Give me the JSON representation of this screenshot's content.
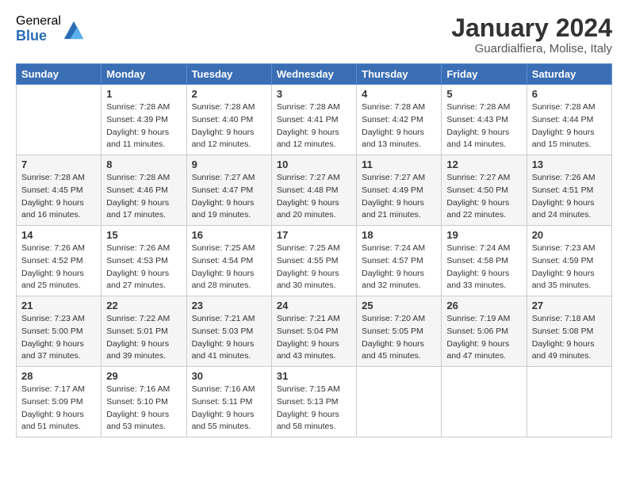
{
  "logo": {
    "general": "General",
    "blue": "Blue"
  },
  "title": "January 2024",
  "location": "Guardialfiera, Molise, Italy",
  "weekdays": [
    "Sunday",
    "Monday",
    "Tuesday",
    "Wednesday",
    "Thursday",
    "Friday",
    "Saturday"
  ],
  "weeks": [
    [
      {
        "day": "",
        "sunrise": "",
        "sunset": "",
        "daylight": ""
      },
      {
        "day": "1",
        "sunrise": "Sunrise: 7:28 AM",
        "sunset": "Sunset: 4:39 PM",
        "daylight": "Daylight: 9 hours and 11 minutes."
      },
      {
        "day": "2",
        "sunrise": "Sunrise: 7:28 AM",
        "sunset": "Sunset: 4:40 PM",
        "daylight": "Daylight: 9 hours and 12 minutes."
      },
      {
        "day": "3",
        "sunrise": "Sunrise: 7:28 AM",
        "sunset": "Sunset: 4:41 PM",
        "daylight": "Daylight: 9 hours and 12 minutes."
      },
      {
        "day": "4",
        "sunrise": "Sunrise: 7:28 AM",
        "sunset": "Sunset: 4:42 PM",
        "daylight": "Daylight: 9 hours and 13 minutes."
      },
      {
        "day": "5",
        "sunrise": "Sunrise: 7:28 AM",
        "sunset": "Sunset: 4:43 PM",
        "daylight": "Daylight: 9 hours and 14 minutes."
      },
      {
        "day": "6",
        "sunrise": "Sunrise: 7:28 AM",
        "sunset": "Sunset: 4:44 PM",
        "daylight": "Daylight: 9 hours and 15 minutes."
      }
    ],
    [
      {
        "day": "7",
        "sunrise": "Sunrise: 7:28 AM",
        "sunset": "Sunset: 4:45 PM",
        "daylight": "Daylight: 9 hours and 16 minutes."
      },
      {
        "day": "8",
        "sunrise": "Sunrise: 7:28 AM",
        "sunset": "Sunset: 4:46 PM",
        "daylight": "Daylight: 9 hours and 17 minutes."
      },
      {
        "day": "9",
        "sunrise": "Sunrise: 7:27 AM",
        "sunset": "Sunset: 4:47 PM",
        "daylight": "Daylight: 9 hours and 19 minutes."
      },
      {
        "day": "10",
        "sunrise": "Sunrise: 7:27 AM",
        "sunset": "Sunset: 4:48 PM",
        "daylight": "Daylight: 9 hours and 20 minutes."
      },
      {
        "day": "11",
        "sunrise": "Sunrise: 7:27 AM",
        "sunset": "Sunset: 4:49 PM",
        "daylight": "Daylight: 9 hours and 21 minutes."
      },
      {
        "day": "12",
        "sunrise": "Sunrise: 7:27 AM",
        "sunset": "Sunset: 4:50 PM",
        "daylight": "Daylight: 9 hours and 22 minutes."
      },
      {
        "day": "13",
        "sunrise": "Sunrise: 7:26 AM",
        "sunset": "Sunset: 4:51 PM",
        "daylight": "Daylight: 9 hours and 24 minutes."
      }
    ],
    [
      {
        "day": "14",
        "sunrise": "Sunrise: 7:26 AM",
        "sunset": "Sunset: 4:52 PM",
        "daylight": "Daylight: 9 hours and 25 minutes."
      },
      {
        "day": "15",
        "sunrise": "Sunrise: 7:26 AM",
        "sunset": "Sunset: 4:53 PM",
        "daylight": "Daylight: 9 hours and 27 minutes."
      },
      {
        "day": "16",
        "sunrise": "Sunrise: 7:25 AM",
        "sunset": "Sunset: 4:54 PM",
        "daylight": "Daylight: 9 hours and 28 minutes."
      },
      {
        "day": "17",
        "sunrise": "Sunrise: 7:25 AM",
        "sunset": "Sunset: 4:55 PM",
        "daylight": "Daylight: 9 hours and 30 minutes."
      },
      {
        "day": "18",
        "sunrise": "Sunrise: 7:24 AM",
        "sunset": "Sunset: 4:57 PM",
        "daylight": "Daylight: 9 hours and 32 minutes."
      },
      {
        "day": "19",
        "sunrise": "Sunrise: 7:24 AM",
        "sunset": "Sunset: 4:58 PM",
        "daylight": "Daylight: 9 hours and 33 minutes."
      },
      {
        "day": "20",
        "sunrise": "Sunrise: 7:23 AM",
        "sunset": "Sunset: 4:59 PM",
        "daylight": "Daylight: 9 hours and 35 minutes."
      }
    ],
    [
      {
        "day": "21",
        "sunrise": "Sunrise: 7:23 AM",
        "sunset": "Sunset: 5:00 PM",
        "daylight": "Daylight: 9 hours and 37 minutes."
      },
      {
        "day": "22",
        "sunrise": "Sunrise: 7:22 AM",
        "sunset": "Sunset: 5:01 PM",
        "daylight": "Daylight: 9 hours and 39 minutes."
      },
      {
        "day": "23",
        "sunrise": "Sunrise: 7:21 AM",
        "sunset": "Sunset: 5:03 PM",
        "daylight": "Daylight: 9 hours and 41 minutes."
      },
      {
        "day": "24",
        "sunrise": "Sunrise: 7:21 AM",
        "sunset": "Sunset: 5:04 PM",
        "daylight": "Daylight: 9 hours and 43 minutes."
      },
      {
        "day": "25",
        "sunrise": "Sunrise: 7:20 AM",
        "sunset": "Sunset: 5:05 PM",
        "daylight": "Daylight: 9 hours and 45 minutes."
      },
      {
        "day": "26",
        "sunrise": "Sunrise: 7:19 AM",
        "sunset": "Sunset: 5:06 PM",
        "daylight": "Daylight: 9 hours and 47 minutes."
      },
      {
        "day": "27",
        "sunrise": "Sunrise: 7:18 AM",
        "sunset": "Sunset: 5:08 PM",
        "daylight": "Daylight: 9 hours and 49 minutes."
      }
    ],
    [
      {
        "day": "28",
        "sunrise": "Sunrise: 7:17 AM",
        "sunset": "Sunset: 5:09 PM",
        "daylight": "Daylight: 9 hours and 51 minutes."
      },
      {
        "day": "29",
        "sunrise": "Sunrise: 7:16 AM",
        "sunset": "Sunset: 5:10 PM",
        "daylight": "Daylight: 9 hours and 53 minutes."
      },
      {
        "day": "30",
        "sunrise": "Sunrise: 7:16 AM",
        "sunset": "Sunset: 5:11 PM",
        "daylight": "Daylight: 9 hours and 55 minutes."
      },
      {
        "day": "31",
        "sunrise": "Sunrise: 7:15 AM",
        "sunset": "Sunset: 5:13 PM",
        "daylight": "Daylight: 9 hours and 58 minutes."
      },
      {
        "day": "",
        "sunrise": "",
        "sunset": "",
        "daylight": ""
      },
      {
        "day": "",
        "sunrise": "",
        "sunset": "",
        "daylight": ""
      },
      {
        "day": "",
        "sunrise": "",
        "sunset": "",
        "daylight": ""
      }
    ]
  ]
}
